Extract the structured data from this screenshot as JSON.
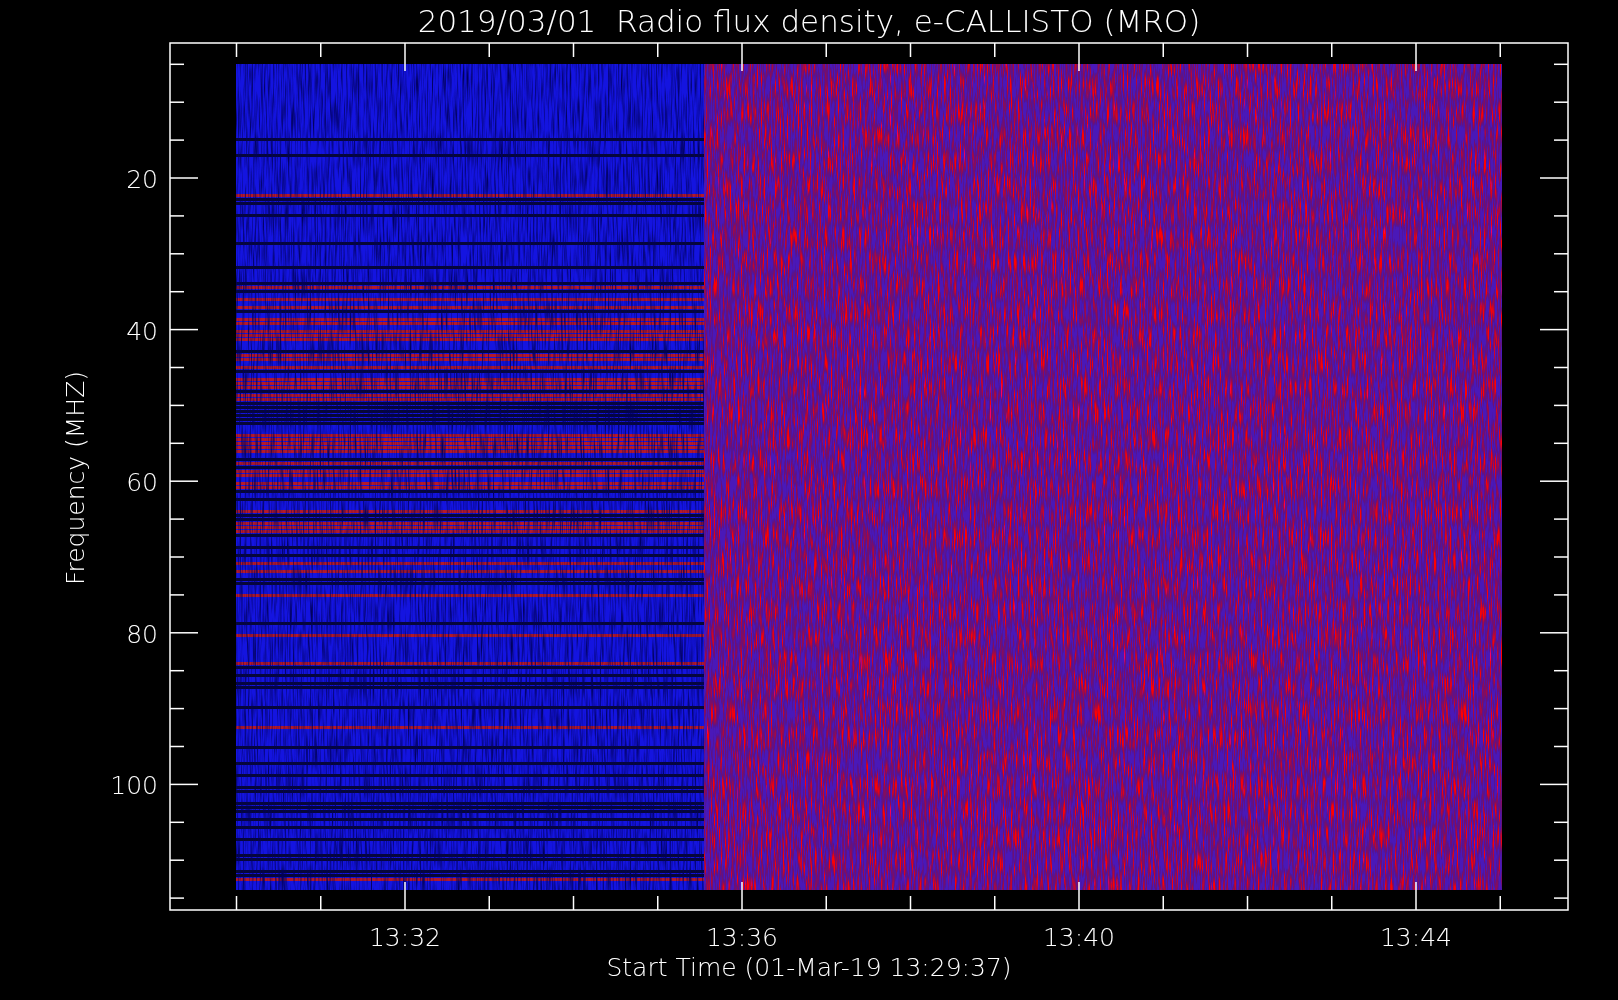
{
  "plot": {
    "title": "2019/03/01  Radio flux density, e-CALLISTO (MRO)",
    "y_axis": {
      "label": "Frequency (MHZ)",
      "ticks": [
        "20",
        "40",
        "60",
        "80",
        "100"
      ]
    },
    "x_axis": {
      "label": "Start Time (01-Mar-19 13:29:37)",
      "ticks": [
        "13:32",
        "13:36",
        "13:40",
        "13:44"
      ]
    }
  }
}
